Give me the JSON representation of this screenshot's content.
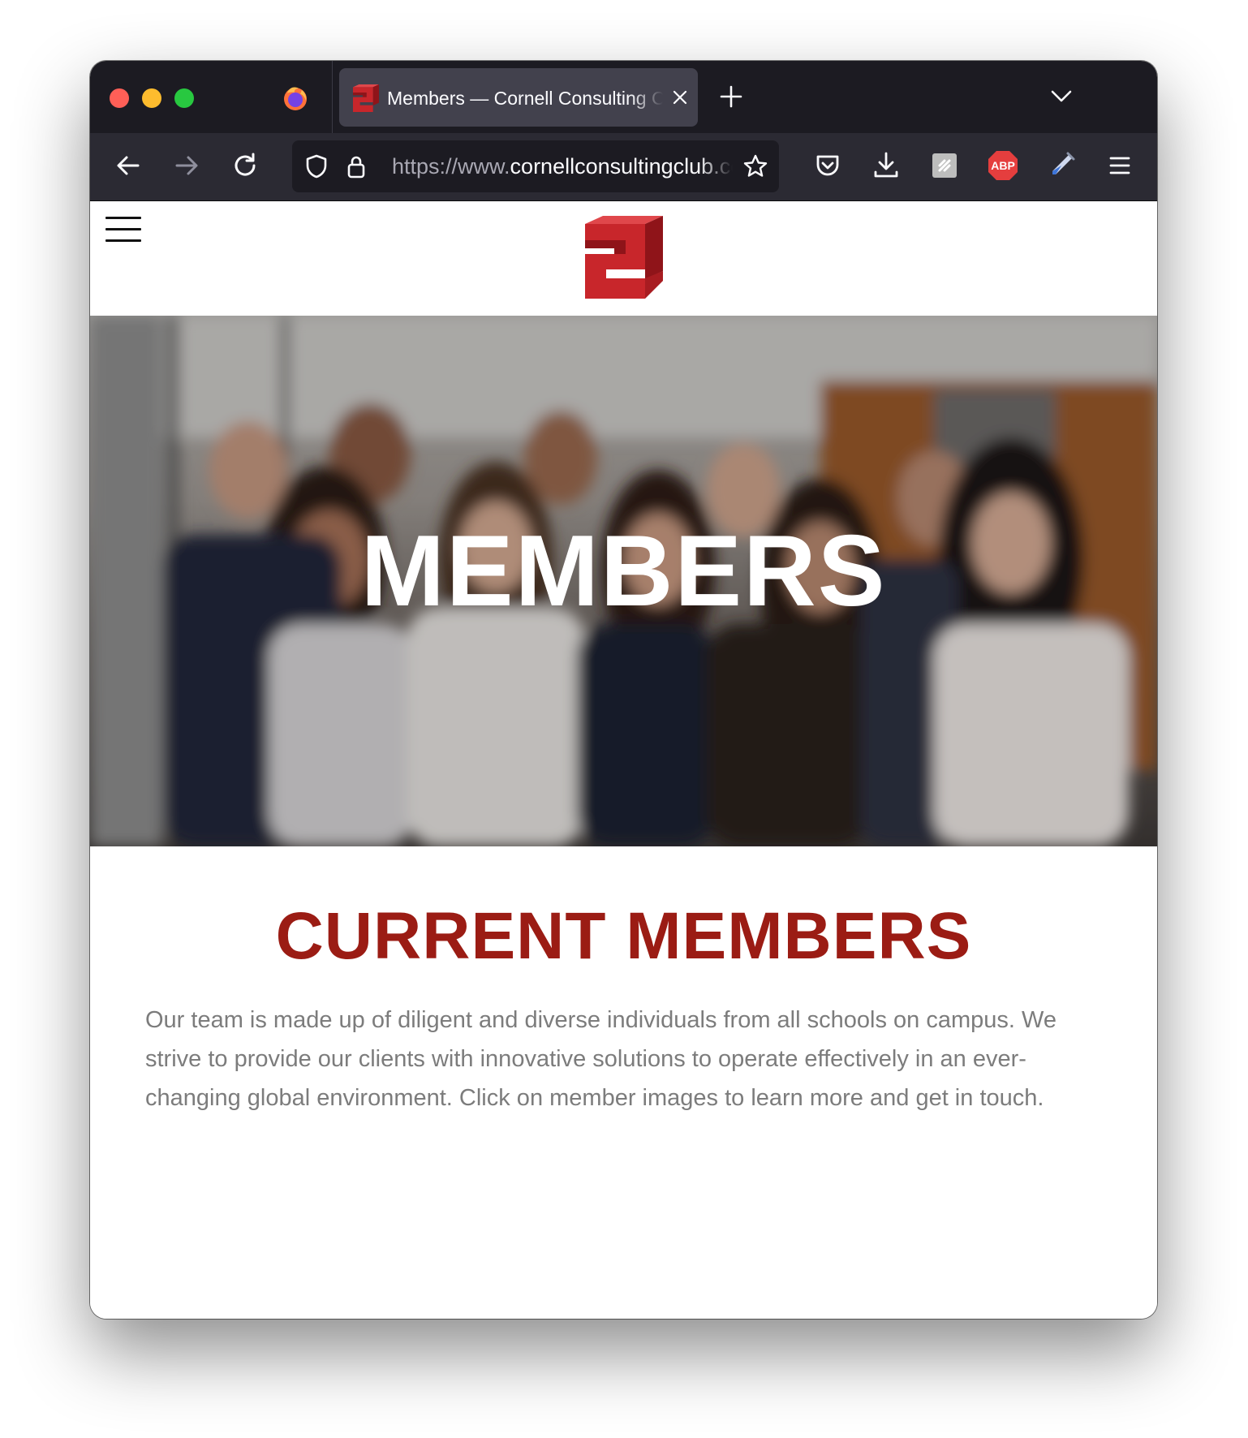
{
  "browser": {
    "tab": {
      "title": "Members — Cornell Consulting Club",
      "close_icon": "close-icon",
      "favicon": "cornell-consulting-logo-icon"
    },
    "new_tab_icon": "plus-icon",
    "tab_list_icon": "chevron-down-icon",
    "nav": {
      "back_icon": "arrow-left-icon",
      "forward_icon": "arrow-right-icon",
      "reload_icon": "reload-icon"
    },
    "urlbar": {
      "scheme": "https://www.",
      "host": "cornellconsultingclub.com/members",
      "shield_icon": "shield-icon",
      "lock_icon": "lock-icon",
      "bookmark_icon": "star-icon"
    },
    "toolbar_icons": [
      "pocket-icon",
      "download-icon",
      "extension-icon",
      "adblock-icon",
      "eyedropper-icon",
      "menu-icon"
    ],
    "adblock_label": "ABP",
    "colors": {
      "tabbar": "#1c1b22",
      "navbar": "#2b2a33",
      "active_tab": "#42414d",
      "close": "#ff5f57",
      "minimize": "#febc2e",
      "maximize": "#28c840"
    }
  },
  "page": {
    "menu_icon": "hamburger-menu-icon",
    "logo": "cornell-consulting-logo",
    "hero": {
      "title": "MEMBERS"
    },
    "section": {
      "title": "CURRENT MEMBERS",
      "body": "Our team is made up of diligent and diverse individuals from all schools on campus. We strive to provide our clients with innovative solutions to operate effectively in an ever-changing global environment. Click on member images to learn more and get in touch."
    },
    "colors": {
      "brand_red": "#c8262b",
      "title_red": "#9b1c14",
      "body_text": "#7c7c7c"
    }
  }
}
